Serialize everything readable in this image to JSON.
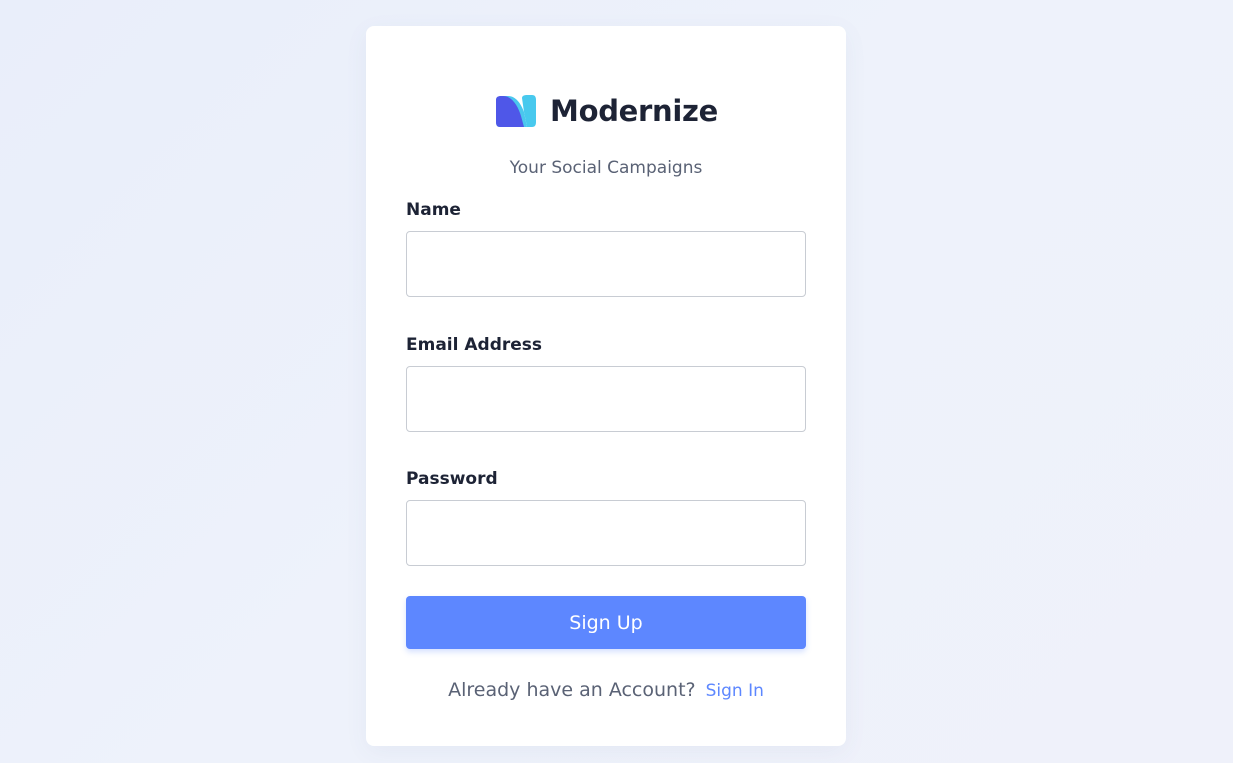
{
  "brand": {
    "name": "Modernize",
    "tagline": "Your Social Campaigns"
  },
  "form": {
    "name_label": "Name",
    "email_label": "Email Address",
    "password_label": "Password",
    "submit_label": "Sign Up"
  },
  "footer": {
    "prompt": "Already have an Account?",
    "signin_link": "Sign In"
  },
  "colors": {
    "primary": "#5d87ff",
    "logo_dark": "#4f57e8",
    "logo_light": "#48c9ee",
    "text_dark": "#1d2335",
    "text_muted": "#5a6275"
  },
  "icons": {
    "logo": "modernize-logo-icon"
  }
}
